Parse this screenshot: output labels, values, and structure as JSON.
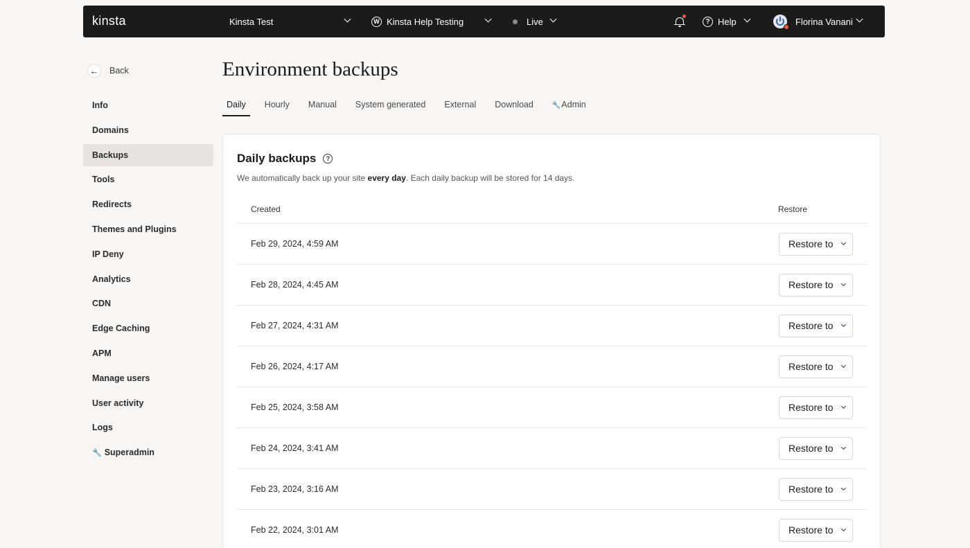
{
  "topbar": {
    "logo": "kinsta",
    "company": "Kinsta Test",
    "site": "Kinsta Help Testing",
    "environment": "Live",
    "help": "Help",
    "user": "Florina Vanani"
  },
  "sidebar": {
    "back": "Back",
    "items": [
      {
        "label": "Info"
      },
      {
        "label": "Domains"
      },
      {
        "label": "Backups",
        "active": true
      },
      {
        "label": "Tools"
      },
      {
        "label": "Redirects"
      },
      {
        "label": "Themes and Plugins"
      },
      {
        "label": "IP Deny"
      },
      {
        "label": "Analytics"
      },
      {
        "label": "CDN"
      },
      {
        "label": "Edge Caching"
      },
      {
        "label": "APM"
      },
      {
        "label": "Manage users"
      },
      {
        "label": "User activity"
      },
      {
        "label": "Logs"
      },
      {
        "label": "Superadmin"
      }
    ]
  },
  "main": {
    "title": "Environment backups",
    "tabs": [
      "Daily",
      "Hourly",
      "Manual",
      "System generated",
      "External",
      "Download",
      "Admin"
    ],
    "active_tab": "Daily",
    "card": {
      "title": "Daily backups",
      "desc_pre": "We automatically back up your site ",
      "desc_bold": "every day",
      "desc_post": ". Each daily backup will be stored for 14 days.",
      "col_created": "Created",
      "col_restore": "Restore",
      "restore_label": "Restore to",
      "rows": [
        "Feb 29, 2024, 4:59 AM",
        "Feb 28, 2024, 4:45 AM",
        "Feb 27, 2024, 4:31 AM",
        "Feb 26, 2024, 4:17 AM",
        "Feb 25, 2024, 3:58 AM",
        "Feb 24, 2024, 3:41 AM",
        "Feb 23, 2024, 3:16 AM",
        "Feb 22, 2024, 3:01 AM"
      ]
    }
  },
  "colors": {
    "topbar_bg": "#1b1b1b",
    "page_bg": "#f8f5f2",
    "active_nav_bg": "#e8e3df",
    "notification": "#ef5a3c"
  }
}
